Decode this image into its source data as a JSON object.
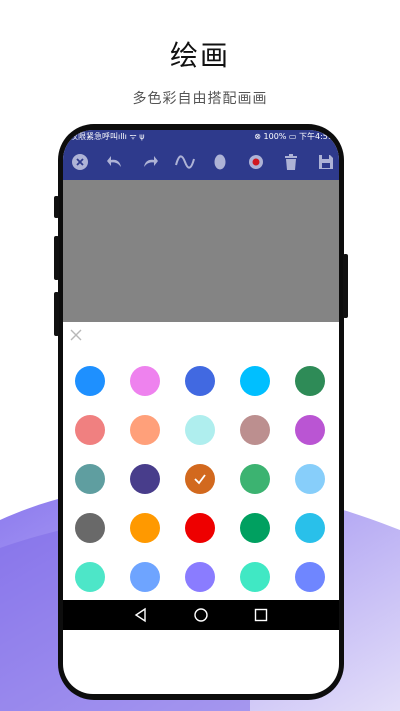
{
  "header": {
    "title": "绘画",
    "subtitle": "多色彩自由搭配画画"
  },
  "statusbar": {
    "left": "汉限紧急呼叫ıllı ᯤ ψ",
    "right": "⊗ 100% ▭ 下午4:59"
  },
  "toolbar": {
    "icons": [
      "close-circle-icon",
      "undo-icon",
      "redo-icon",
      "pen-curve-icon",
      "eraser-icon",
      "color-palette-icon",
      "trash-icon",
      "save-icon"
    ]
  },
  "palette": {
    "selected_index": 12,
    "colors": [
      "#1e90ff",
      "#ee82ee",
      "#4169e1",
      "#00bfff",
      "#2e8b57",
      "#f08080",
      "#ffa07a",
      "#afeeee",
      "#bc8f8f",
      "#ba55d3",
      "#5f9ea0",
      "#483d8b",
      "#d2691e",
      "#3cb371",
      "#87cefa",
      "#696969",
      "#ff9900",
      "#ee0000",
      "#00a060",
      "#29c0ea",
      "#4de6c8",
      "#6ea4ff",
      "#8a7cff",
      "#40e8c4",
      "#6f86ff"
    ]
  },
  "colors": {
    "toolbar_bg": "#2e3a8c",
    "canvas_bg": "#848484",
    "accent_wave": "#8f7ef0"
  }
}
